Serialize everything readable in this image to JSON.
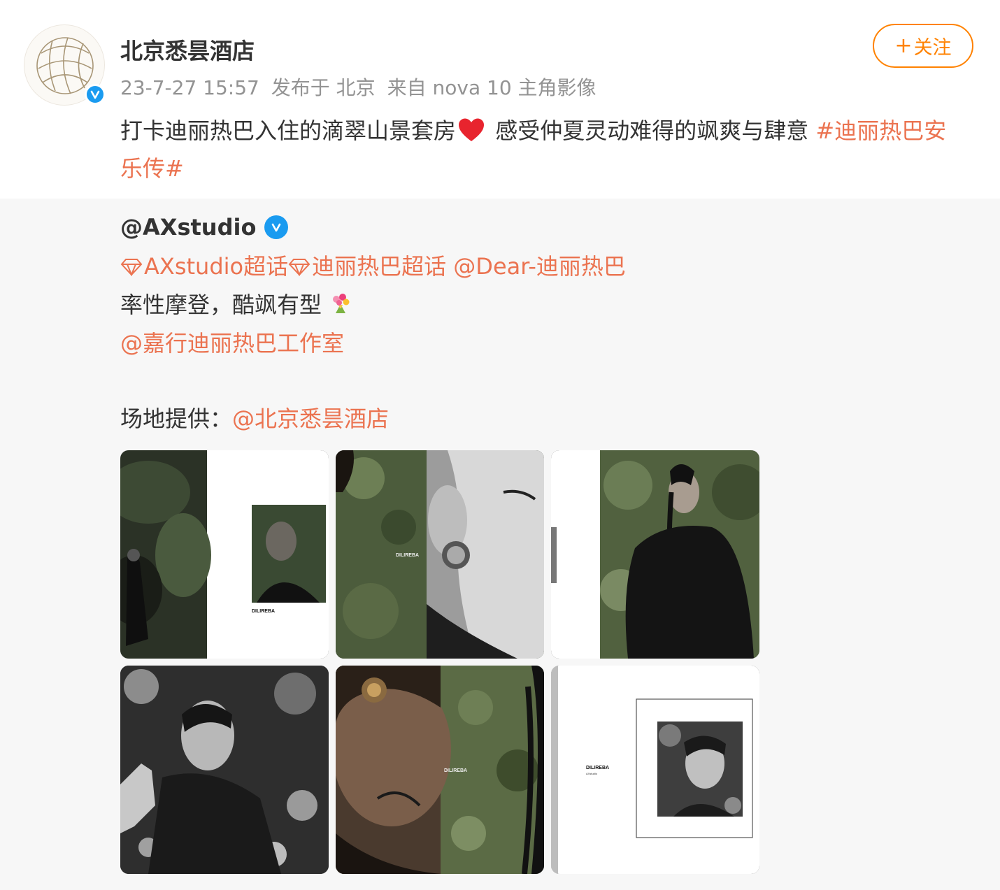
{
  "post": {
    "author": "北京悉昙酒店",
    "timestamp": "23-7-27 15:57",
    "location": "发布于 北京",
    "source": "来自 nova 10 主角影像",
    "follow_label": "关注",
    "follow_plus": "+",
    "text_before": "打卡迪丽热巴入住的滴翠山景套房",
    "text_after": " 感受仲夏灵动难得的飒爽与肆意 ",
    "hashtag": "#迪丽热巴安乐传#"
  },
  "repost": {
    "author": "@AXstudio",
    "super_topic_1": "AXstudio超话",
    "super_topic_2": "迪丽热巴超话",
    "mention_dear": "@Dear-迪丽热巴",
    "caption": "率性摩登，酷飒有型",
    "mention_studio": "@嘉行迪丽热巴工作室",
    "venue_label": "场地提供：",
    "venue_mention": "@北京悉昙酒店",
    "photo_texts": {
      "brand": "DILIREBA",
      "tiny": "AXstudio"
    }
  },
  "icons": {
    "verified": "verified-badge-icon",
    "heart": "red-heart-emoji",
    "super_topic": "diamond-super-topic-icon",
    "bouquet": "bouquet-emoji"
  },
  "colors": {
    "accent_orange": "#ff8200",
    "link": "#eb7350",
    "verified_blue": "#1a9bf0",
    "meta_gray": "#939393"
  }
}
